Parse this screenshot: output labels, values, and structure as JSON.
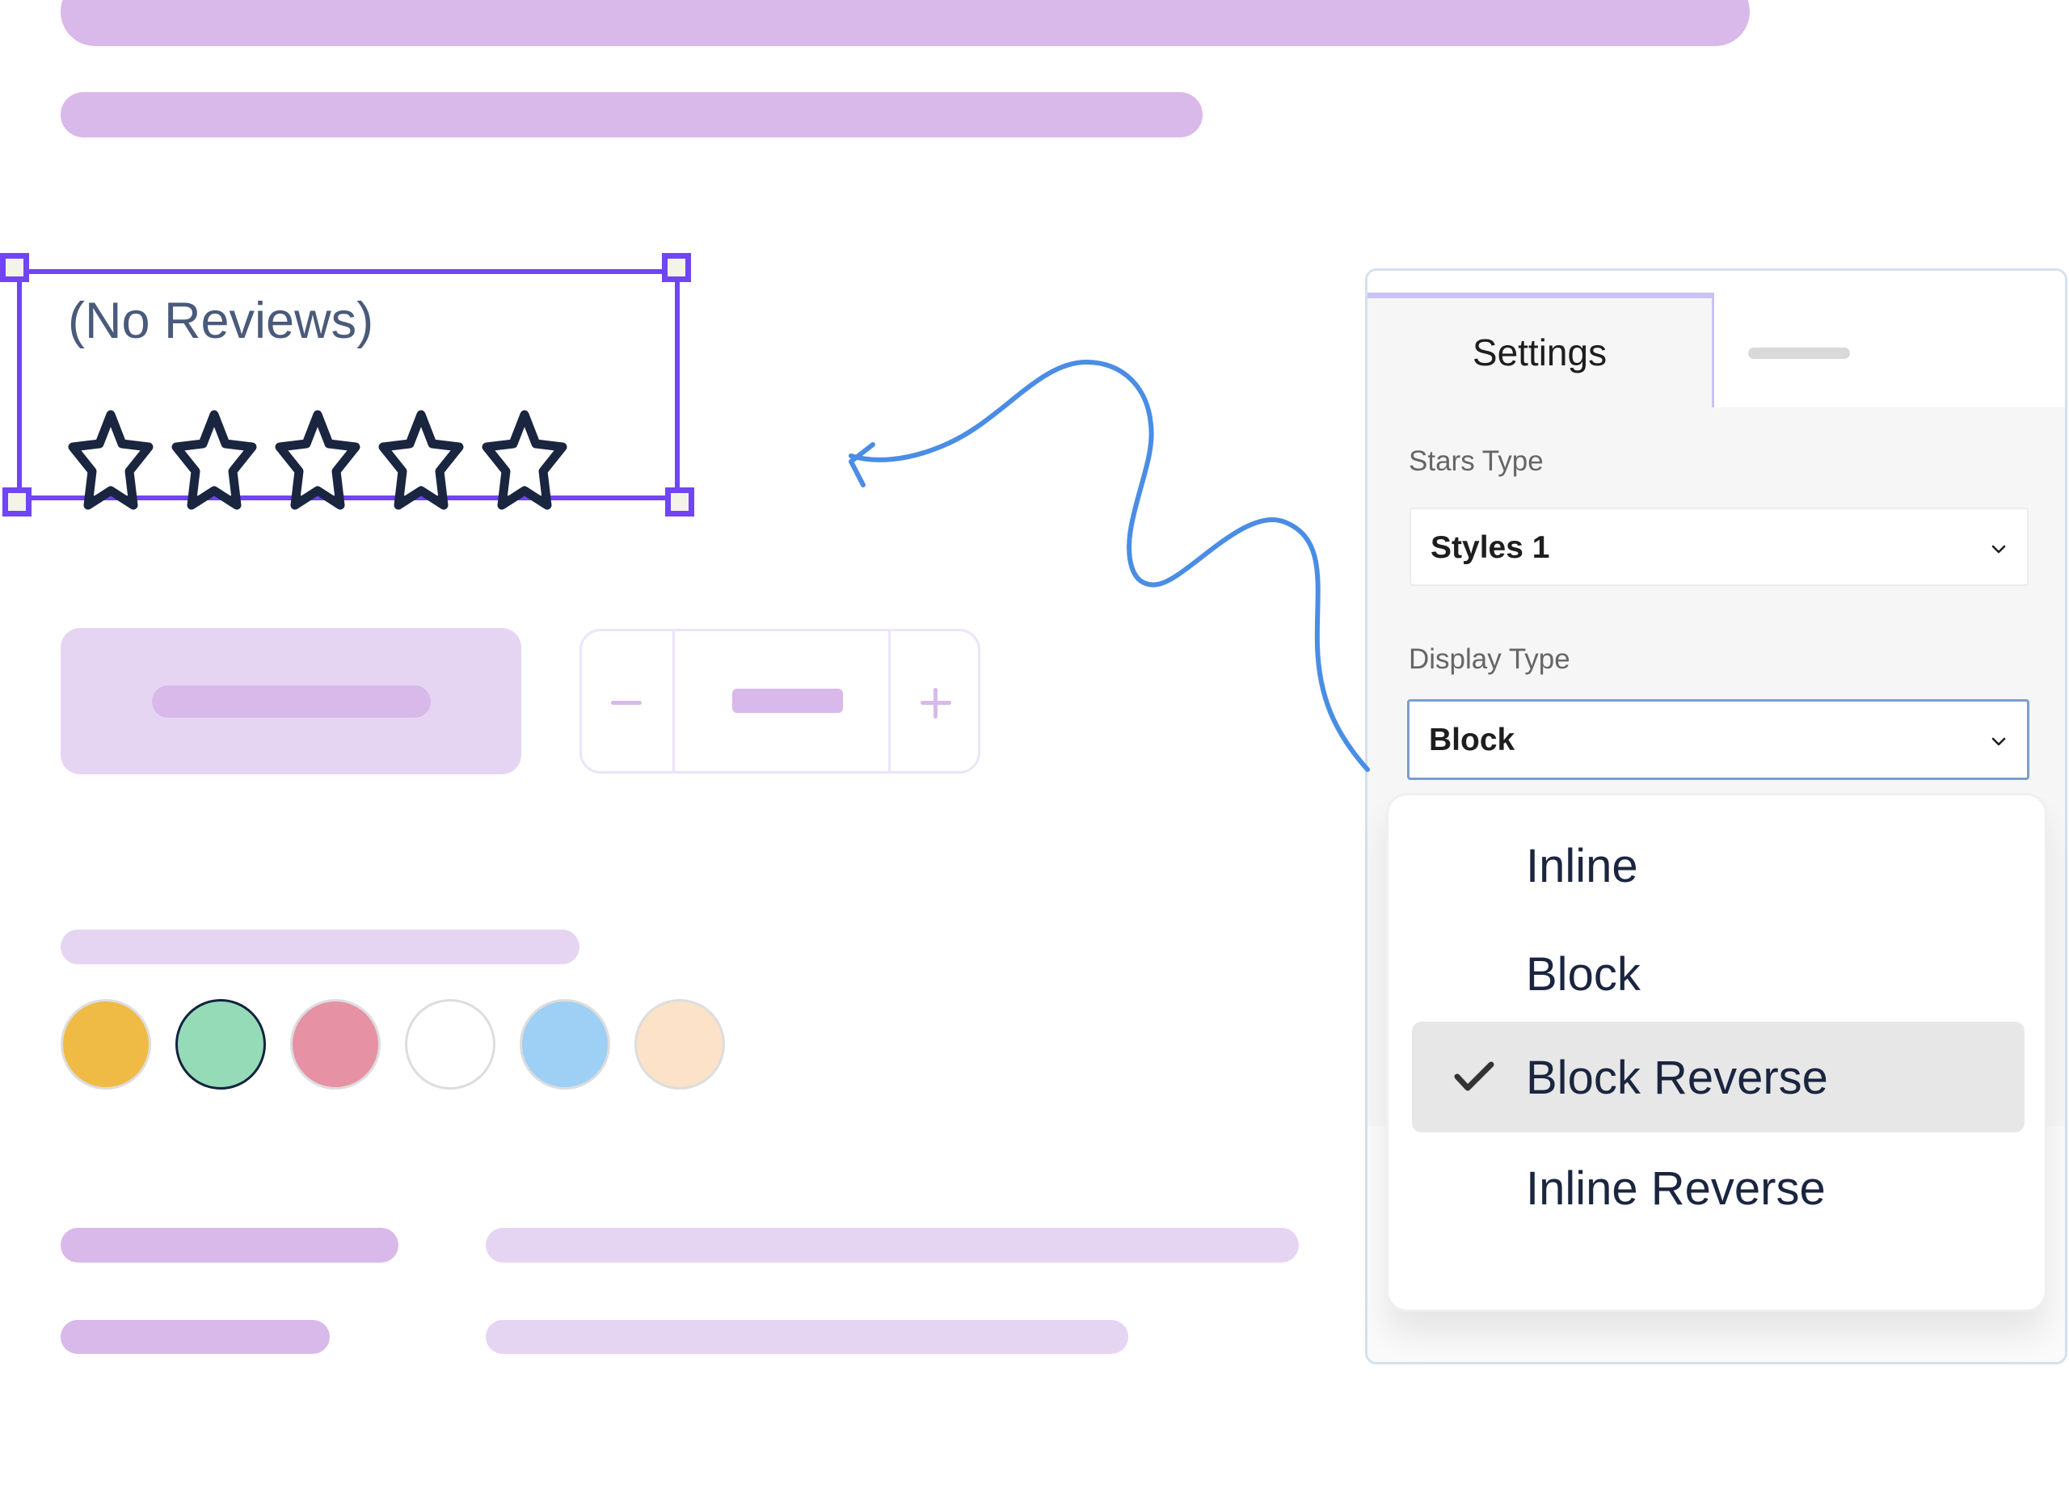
{
  "review_widget": {
    "reviews_text": "(No Reviews)",
    "rating": {
      "value": 0,
      "max": 5
    },
    "icon": "star-outline-icon",
    "star_color": "#1a2540",
    "selection_color": "#6f45f5"
  },
  "stepper": {
    "minus_icon": "minus-icon",
    "plus_icon": "plus-icon"
  },
  "swatches": {
    "colors": [
      "#f0bb45",
      "#96dbb8",
      "#e791a5",
      "#ffffff",
      "#9ecff4",
      "#fbe2c9"
    ],
    "selected_index": 1
  },
  "arrow": {
    "icon": "curly-arrow-icon",
    "color": "#4a8de5"
  },
  "settings_panel": {
    "tabs": [
      {
        "label": "Settings",
        "active": true
      },
      {
        "label": "",
        "active": false
      }
    ],
    "fields": [
      {
        "label": "Stars Type",
        "value": "Styles 1",
        "icon": "chevron-down-icon"
      },
      {
        "label": "Display Type",
        "value": "Block",
        "icon": "chevron-down-icon",
        "open": true
      }
    ],
    "dropdown": {
      "options": [
        {
          "label": "Inline",
          "checked": false
        },
        {
          "label": "Block",
          "checked": false
        },
        {
          "label": "Block Reverse",
          "checked": true
        },
        {
          "label": "Inline Reverse",
          "checked": false
        }
      ],
      "check_icon": "checkmark-icon"
    }
  }
}
